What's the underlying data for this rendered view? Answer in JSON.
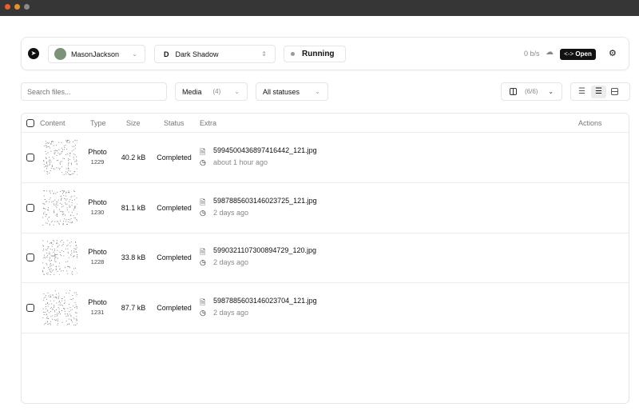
{
  "window": {
    "dots": [
      "#e8602c",
      "#e8902c",
      "#8a8a8a"
    ]
  },
  "header": {
    "account": "MasonJackson",
    "profile_initial": "D",
    "profile": "Dark Shadow",
    "status": "Running",
    "speed": "0 b/s",
    "open_label": "Open",
    "open_icon": "<->"
  },
  "filters": {
    "search_placeholder": "Search files...",
    "media_label": "Media",
    "media_count": "(4)",
    "status_label": "All statuses",
    "columns_count": "(6/6)"
  },
  "table": {
    "columns": [
      "Content",
      "Type",
      "Size",
      "Status",
      "Extra",
      "Actions"
    ],
    "rows": [
      {
        "type": "Photo",
        "id": "1229",
        "size": "40.2 kB",
        "status": "Completed",
        "file": "5994500436897416442_121.jpg",
        "time": "about 1 hour ago"
      },
      {
        "type": "Photo",
        "id": "1230",
        "size": "81.1 kB",
        "status": "Completed",
        "file": "5987885603146023725_121.jpg",
        "time": "2 days ago"
      },
      {
        "type": "Photo",
        "id": "1228",
        "size": "33.8 kB",
        "status": "Completed",
        "file": "5990321107300894729_120.jpg",
        "time": "2 days ago"
      },
      {
        "type": "Photo",
        "id": "1231",
        "size": "87.7 kB",
        "status": "Completed",
        "file": "5987885603146023704_121.jpg",
        "time": "2 days ago"
      }
    ]
  }
}
